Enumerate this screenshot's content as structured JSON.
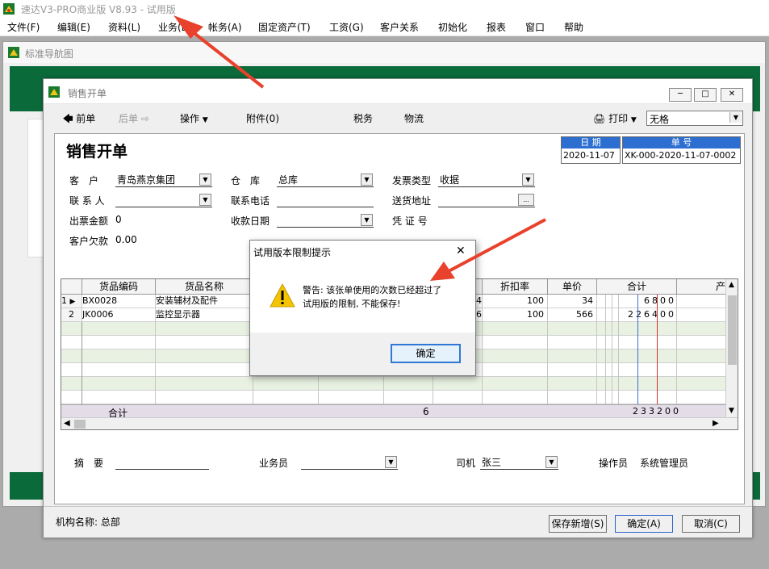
{
  "app": {
    "title": "速达V3-PRO商业版 V8.93 - 试用版"
  },
  "menu": [
    "文件(F)",
    "编辑(E)",
    "资料(L)",
    "业务(B)",
    "帐务(A)",
    "固定资产(T)",
    "工资(G)",
    "客户关系",
    "初始化",
    "报表",
    "窗口",
    "帮助"
  ],
  "nav_window": {
    "title": "标准导航图"
  },
  "sales_window": {
    "title": "销售开单",
    "toolbar": {
      "prev": "前单",
      "next": "后单",
      "operate": "操作",
      "attach": "附件(0)",
      "tax": "税务",
      "logistics": "物流",
      "print": "打印",
      "print_format": "无格"
    },
    "form": {
      "heading": "销售开单",
      "date_label": "日 期",
      "date_value": "2020-11-07",
      "no_label": "单 号",
      "no_value": "XK-000-2020-11-07-0002",
      "customer_label": "客　户",
      "customer_value": "青岛燕京集团",
      "warehouse_label": "仓　库",
      "warehouse_value": "总库",
      "invoice_type_label": "发票类型",
      "invoice_type_value": "收据",
      "contact_label": "联 系 人",
      "phone_label": "联系电话",
      "address_label": "送货地址",
      "invoice_amount_label": "出票金额",
      "invoice_amount_value": "0",
      "receive_date_label": "收款日期",
      "voucher_label": "凭 证 号",
      "debt_label": "客户欠款",
      "debt_value": "0.00"
    },
    "grid": {
      "headers": [
        "货品编码",
        "货品名称",
        "折扣率",
        "单价",
        "合计"
      ],
      "rows": [
        {
          "no": "1",
          "code": "BX0028",
          "name": "安装辅材及配件",
          "qty": "4",
          "discount": "100",
          "price": "34",
          "total": "6800"
        },
        {
          "no": "2",
          "code": "JK0006",
          "name": "监控显示器",
          "qty": "6",
          "discount": "100",
          "price": "566",
          "total": "226400"
        }
      ],
      "footer_label": "合计",
      "footer_qty": "6",
      "footer_total": "233200"
    },
    "bottom": {
      "summary_label": "摘　要",
      "salesman_label": "业务员",
      "driver_label": "司机",
      "driver_value": "张三",
      "operator_label": "操作员",
      "operator_value": "系统管理员"
    },
    "status": {
      "org_label": "机构名称: 总部",
      "save_new": "保存新增(S)",
      "ok": "确定(A)",
      "cancel": "取消(C)"
    }
  },
  "dialog": {
    "title": "试用版本限制提示",
    "message_line1": "警告: 该张单使用的次数已经超过了",
    "message_line2": "试用版的限制, 不能保存!",
    "ok": "确定"
  }
}
